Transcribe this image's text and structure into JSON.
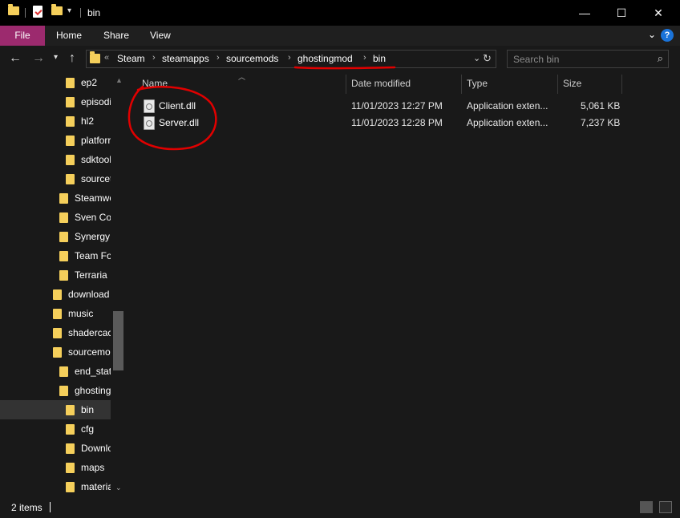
{
  "window": {
    "title": "bin",
    "minimize_glyph": "—",
    "maximize_glyph": "☐",
    "close_glyph": "✕"
  },
  "ribbon": {
    "tabs": [
      "File",
      "Home",
      "Share",
      "View"
    ],
    "help": "?"
  },
  "address": {
    "overflow": "«",
    "crumbs": [
      "Steam",
      "steamapps",
      "sourcemods",
      "ghostingmod",
      "bin"
    ],
    "separator": "›"
  },
  "search": {
    "placeholder": "Search bin"
  },
  "tree": {
    "items": [
      {
        "label": "ep2"
      },
      {
        "label": "episodi"
      },
      {
        "label": "hl2"
      },
      {
        "label": "platforr"
      },
      {
        "label": "sdktool"
      },
      {
        "label": "sourcet"
      },
      {
        "label": "Steamwo"
      },
      {
        "label": "Sven Co-"
      },
      {
        "label": "Synergy"
      },
      {
        "label": "Team For"
      },
      {
        "label": "Terraria"
      },
      {
        "label": "download"
      },
      {
        "label": "music"
      },
      {
        "label": "shadercac"
      },
      {
        "label": "sourcemo"
      },
      {
        "label": "end_stati"
      },
      {
        "label": "ghosting"
      },
      {
        "label": "bin"
      },
      {
        "label": "cfg"
      },
      {
        "label": "Downlo"
      },
      {
        "label": "maps"
      },
      {
        "label": "materia"
      }
    ]
  },
  "columns": {
    "name": "Name",
    "date": "Date modified",
    "type": "Type",
    "size": "Size"
  },
  "files": [
    {
      "name": "Client.dll",
      "date": "11/01/2023 12:27 PM",
      "type": "Application exten...",
      "size": "5,061 KB"
    },
    {
      "name": "Server.dll",
      "date": "11/01/2023 12:28 PM",
      "type": "Application exten...",
      "size": "7,237 KB"
    }
  ],
  "status": {
    "count": "2 items"
  },
  "colors": {
    "file_tab": "#9c2a6e",
    "folder": "#f5cf5b",
    "annotation": "#e00000",
    "help": "#1a73d9"
  }
}
